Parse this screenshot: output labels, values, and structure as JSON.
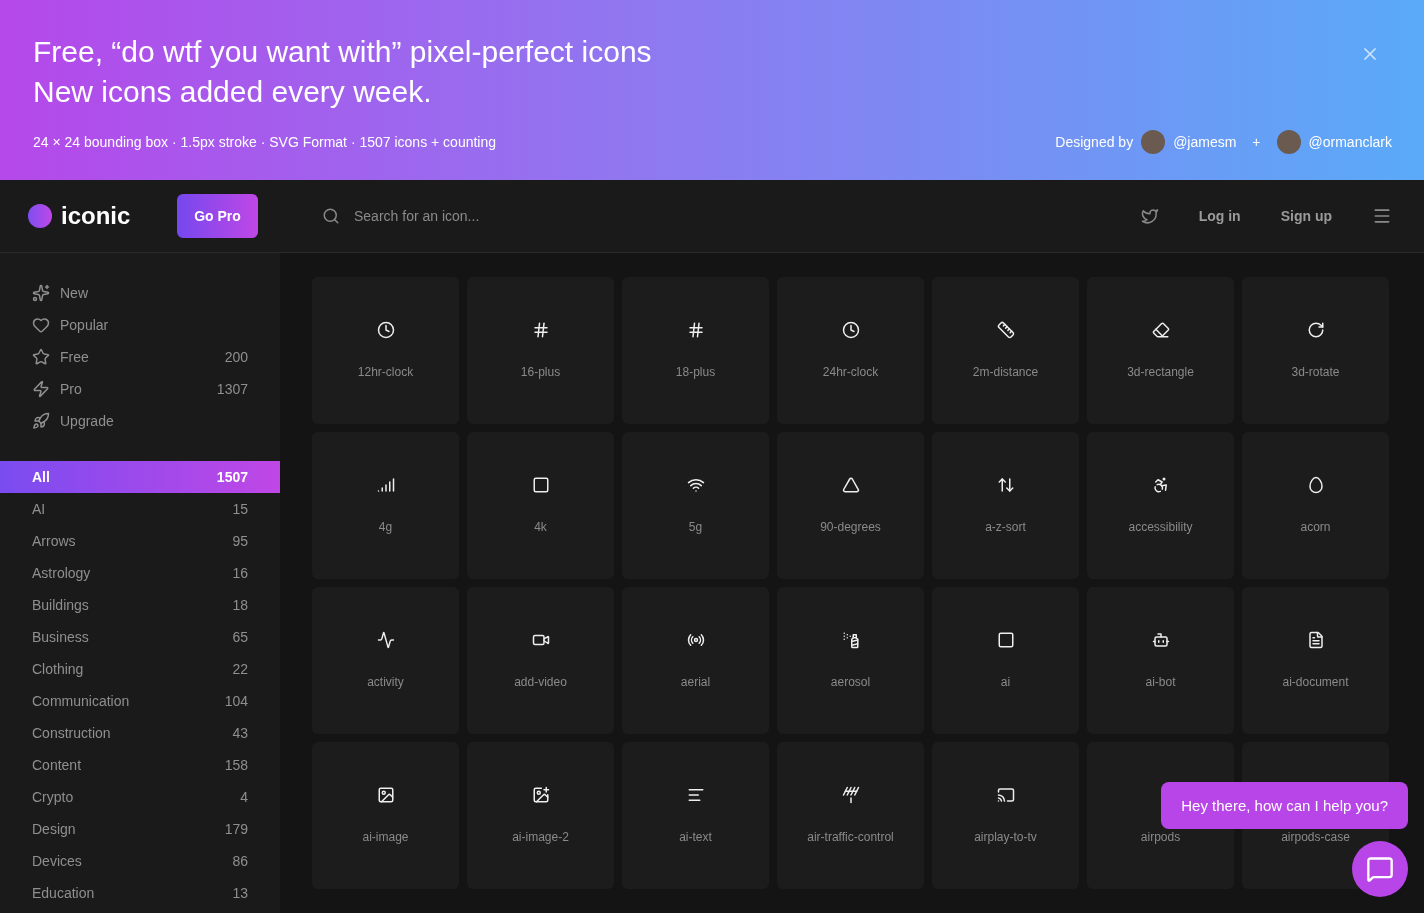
{
  "banner": {
    "headline": [
      "Free, “do wtf you want with” pixel-perfect icons",
      "New icons added every week."
    ],
    "specs": "24 × 24 bounding box · 1.5px stroke · SVG Format · 1507 icons + counting",
    "credit_label": "Designed by",
    "designers": [
      "@jamesm",
      "@ormanclark"
    ],
    "separator": "+"
  },
  "navbar": {
    "logo": "iconic",
    "go_pro": "Go Pro",
    "search": {
      "placeholder": "Search for an icon..."
    },
    "links": [
      "Log in",
      "Sign up"
    ]
  },
  "sidebar": {
    "items": [
      {
        "kind": "new",
        "label": "New"
      },
      {
        "kind": "popular",
        "label": "Popular"
      },
      {
        "kind": "free",
        "label": "Free",
        "count": "200"
      },
      {
        "kind": "pro",
        "label": "Pro",
        "count": "1307"
      },
      {
        "kind": "upgrade",
        "label": "Upgrade"
      }
    ],
    "categories": [
      {
        "label": "All",
        "count": "1507",
        "selected": true
      },
      {
        "label": "AI",
        "count": "15",
        "selected": false
      },
      {
        "label": "Arrows",
        "count": "95",
        "selected": false
      },
      {
        "label": "Astrology",
        "count": "16",
        "selected": false
      },
      {
        "label": "Buildings",
        "count": "18",
        "selected": false
      },
      {
        "label": "Business",
        "count": "65",
        "selected": false
      },
      {
        "label": "Clothing",
        "count": "22",
        "selected": false
      },
      {
        "label": "Communication",
        "count": "104",
        "selected": false
      },
      {
        "label": "Construction",
        "count": "43",
        "selected": false
      },
      {
        "label": "Content",
        "count": "158",
        "selected": false
      },
      {
        "label": "Crypto",
        "count": "4",
        "selected": false
      },
      {
        "label": "Design",
        "count": "179",
        "selected": false
      },
      {
        "label": "Devices",
        "count": "86",
        "selected": false
      },
      {
        "label": "Education",
        "count": "13",
        "selected": false
      }
    ]
  },
  "icons": [
    "12hr-clock",
    "16-plus",
    "18-plus",
    "24hr-clock",
    "2m-distance",
    "3d-rectangle",
    "3d-rotate",
    "4g",
    "4k",
    "5g",
    "90-degrees",
    "a-z-sort",
    "accessibility",
    "acorn",
    "activity",
    "add-video",
    "aerial",
    "aerosol",
    "ai",
    "ai-bot",
    "ai-document",
    "ai-image",
    "ai-image-2",
    "ai-text",
    "air-traffic-control",
    "airplay-to-tv",
    "airpods",
    "airpods-case"
  ],
  "chat": {
    "message": "Hey there, how can I help you?"
  }
}
